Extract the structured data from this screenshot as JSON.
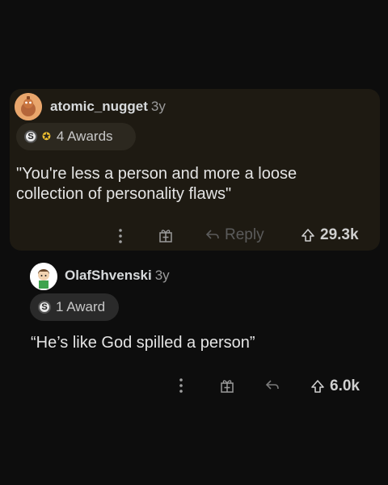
{
  "comments": [
    {
      "username": "atomic_nugget",
      "age": "3y",
      "awards_label": "4 Awards",
      "body": "\"You're less a person and more a loose collection of personality flaws\"",
      "reply_label": "Reply",
      "score": "29.3k"
    },
    {
      "username": "OlafShvenski",
      "age": "3y",
      "awards_label": "1 Award",
      "body": "“He’s like God spilled a person”",
      "score": "6.0k"
    }
  ],
  "icons": {
    "more": "more-vertical-icon",
    "gift": "gift-icon",
    "reply": "reply-icon",
    "upvote": "upvote-icon",
    "coin": "silver-coin-icon",
    "medal": "medal-icon"
  },
  "colors": {
    "background": "#0d0d0d",
    "highlight": "#1e1a12",
    "text": "#d7dadc"
  }
}
